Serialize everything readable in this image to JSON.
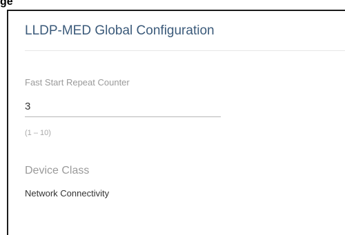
{
  "header_fragment": "ge",
  "panel": {
    "title": "LLDP-MED Global Configuration",
    "fast_start": {
      "label": "Fast Start Repeat Counter",
      "value": "3",
      "hint": "(1 – 10)"
    },
    "device_class": {
      "label": "Device Class",
      "value": "Network Connectivity"
    }
  }
}
